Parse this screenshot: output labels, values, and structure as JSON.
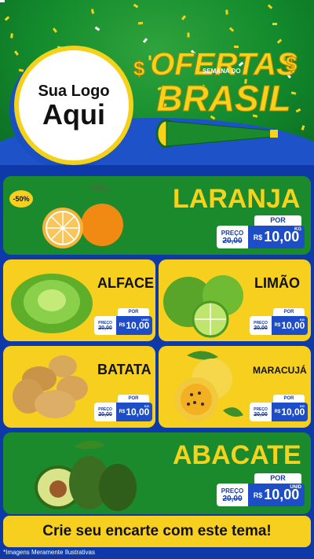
{
  "logo": {
    "line1": "Sua Logo",
    "line2": "Aqui"
  },
  "promo": {
    "title_top": "OFERTAS",
    "subtitle": "SEMANA DO",
    "title_bottom": "BRASIL",
    "currency_symbol": "$"
  },
  "price_labels": {
    "preco": "PREÇO",
    "por": "POR",
    "currency": "R$"
  },
  "products": [
    {
      "name": "LARANJA",
      "discount": "-50%",
      "old_price": "20,00",
      "price": "10,00",
      "unit": "KG"
    },
    {
      "name": "ALFACE",
      "old_price": "20,00",
      "price": "10,00",
      "unit": "UNID"
    },
    {
      "name": "LIMÃO",
      "old_price": "20,00",
      "price": "10,00",
      "unit": "KG"
    },
    {
      "name": "BATATA",
      "old_price": "20,00",
      "price": "10,00",
      "unit": "KG"
    },
    {
      "name": "MARACUJÁ",
      "old_price": "20,00",
      "price": "10,00",
      "unit": "KG"
    },
    {
      "name": "ABACATE",
      "old_price": "20,00",
      "price": "10,00",
      "unit": "UNID"
    }
  ],
  "banner": "Crie seu encarte com este tema!",
  "footnote": "*Imagens Meramente Ilustrativas",
  "colors": {
    "green": "#1b8a2d",
    "yellow": "#f7cf1e",
    "blue": "#1d4ec7"
  }
}
